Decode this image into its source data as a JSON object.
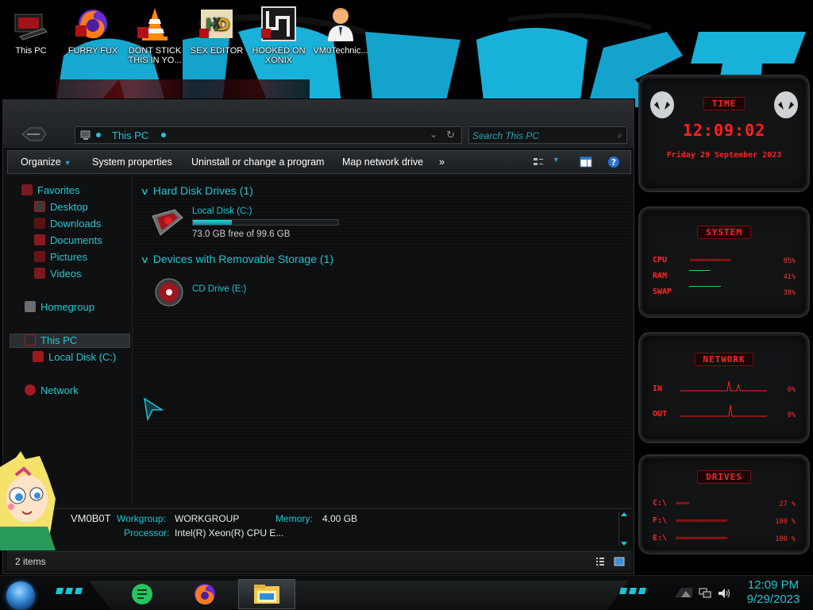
{
  "desktop": {
    "icons": [
      {
        "label": "This PC",
        "icon": "this-pc-icon"
      },
      {
        "label": "FURRY FUX",
        "icon": "firefox-icon"
      },
      {
        "label": "DONT STICK THIS IN YO...",
        "icon": "vlc-cone-icon"
      },
      {
        "label": "SEX EDITOR",
        "icon": "hxd-editor-icon"
      },
      {
        "label": "HOOKED ON XONIX",
        "icon": "xonix-game-icon"
      },
      {
        "label": "VM0Technic...",
        "icon": "doctor-avatar-icon"
      }
    ]
  },
  "explorer": {
    "address": {
      "root": "This PC"
    },
    "search": {
      "placeholder": "Search This PC"
    },
    "commands": {
      "organize": "Organize",
      "system_properties": "System properties",
      "uninstall": "Uninstall or change a program",
      "map_drive": "Map network drive",
      "more": "»"
    },
    "nav": {
      "favorites": "Favorites",
      "desktop": "Desktop",
      "downloads": "Downloads",
      "documents": "Documents",
      "pictures": "Pictures",
      "videos": "Videos",
      "homegroup": "Homegroup",
      "this_pc": "This PC",
      "local_disk": "Local Disk (C:)",
      "network": "Network"
    },
    "groups": {
      "hard_disks": "Hard Disk Drives (1)",
      "removable": "Devices with Removable Storage (1)"
    },
    "drives": {
      "c": {
        "name": "Local Disk (C:)",
        "free_text": "73.0 GB free of 99.6 GB",
        "used_fraction": 0.27
      },
      "e": {
        "name": "CD Drive (E:)"
      }
    },
    "details": {
      "computer_name": "VM0B0T",
      "workgroup_label": "Workgroup:",
      "workgroup_value": "WORKGROUP",
      "memory_label": "Memory:",
      "memory_value": "4.00 GB",
      "processor_label": "Processor:",
      "processor_value": "Intel(R) Xeon(R) CPU E..."
    },
    "status": {
      "items": "2 items"
    }
  },
  "gadgets": {
    "time": {
      "title": "TIME",
      "clock": "12:09:02",
      "date": "Friday 29 September 2023"
    },
    "system": {
      "title": "SYSTEM",
      "cpu_label": "CPU",
      "cpu_value": "85%",
      "ram_label": "RAM",
      "ram_value": "41%",
      "swap_label": "SWAP",
      "swap_value": "38%"
    },
    "network": {
      "title": "NETWORK",
      "in_label": "IN",
      "in_value": "0%",
      "out_label": "OUT",
      "out_value": "0%"
    },
    "drives": {
      "title": "DRIVES",
      "rows": [
        {
          "label": "C:\\",
          "value": "27 %"
        },
        {
          "label": "F:\\",
          "value": "100 %"
        },
        {
          "label": "E:\\",
          "value": "100 %"
        }
      ]
    }
  },
  "taskbar": {
    "apps": [
      "notes-app-icon",
      "firefox-icon",
      "file-explorer-icon"
    ],
    "time": "12:09 PM",
    "date": "9/29/2023"
  },
  "colors": {
    "accent": "#19c5d3",
    "gadget_red": "#ff2020",
    "window_bg": "#101214"
  }
}
